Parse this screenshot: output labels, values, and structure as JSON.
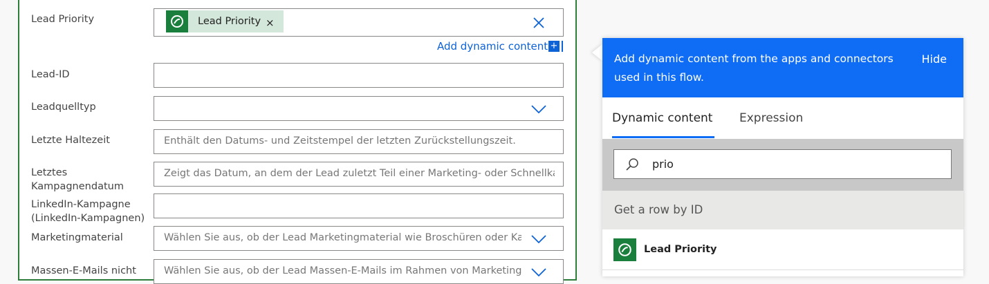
{
  "form": {
    "lead_priority": {
      "label": "Lead Priority",
      "token": "Lead Priority",
      "token_remove": "×"
    },
    "add_dynamic": {
      "label": "Add dynamic content",
      "button": "+"
    },
    "fields": [
      {
        "label": "Lead-ID",
        "placeholder": ""
      },
      {
        "label": "Leadquelltyp",
        "placeholder": ""
      },
      {
        "label": "Letzte Haltezeit",
        "placeholder": "Enthält den Datums- und Zeitstempel der letzten Zurückstellungszeit."
      },
      {
        "label_line1": "Letztes",
        "label_line2": "Kampagnendatum",
        "placeholder": "Zeigt das Datum, an dem der Lead zuletzt Teil einer Marketing- oder Schnellkar"
      },
      {
        "label_line1": "LinkedIn-Kampagne",
        "label_line2": "(LinkedIn-Kampagnen)",
        "placeholder": ""
      },
      {
        "label": "Marketingmaterial",
        "placeholder": "Wählen Sie aus, ob der Lead Marketingmaterial wie Broschüren oder Kata"
      },
      {
        "label": "Massen-E-Mails nicht",
        "placeholder": "Wählen Sie aus, ob der Lead Massen-E-Mails im Rahmen von Marketing"
      }
    ]
  },
  "panel": {
    "header_text": "Add dynamic content from the apps and connectors used in this flow.",
    "hide_label": "Hide",
    "tabs": [
      {
        "label": "Dynamic content",
        "active": true
      },
      {
        "label": "Expression",
        "active": false
      }
    ],
    "search_value": "prio",
    "group_title": "Get a row by ID",
    "results": [
      {
        "label": "Lead Priority",
        "icon": "dataverse-icon"
      }
    ]
  },
  "colors": {
    "accent": "#0f6cf5",
    "brand_green": "#1a7f3d",
    "card_border": "#2f7d3b"
  }
}
